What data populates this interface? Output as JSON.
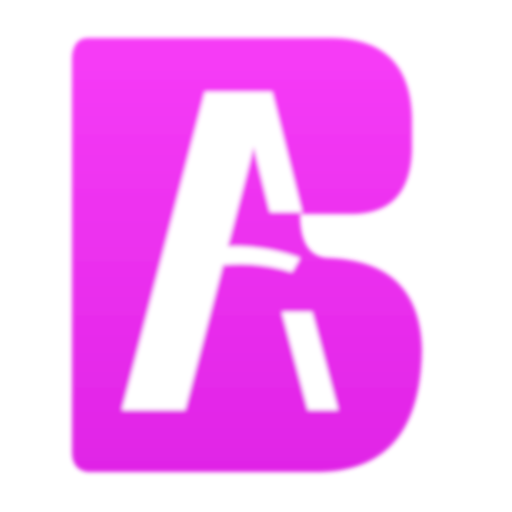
{
  "app_icon": {
    "icon": "letter-a-b-logo",
    "letters": "AB",
    "colors": {
      "gradient_top": "#f73cf7",
      "gradient_bottom": "#e024e6",
      "letter_stroke": "#ffffff",
      "background": "#ffffff"
    }
  }
}
